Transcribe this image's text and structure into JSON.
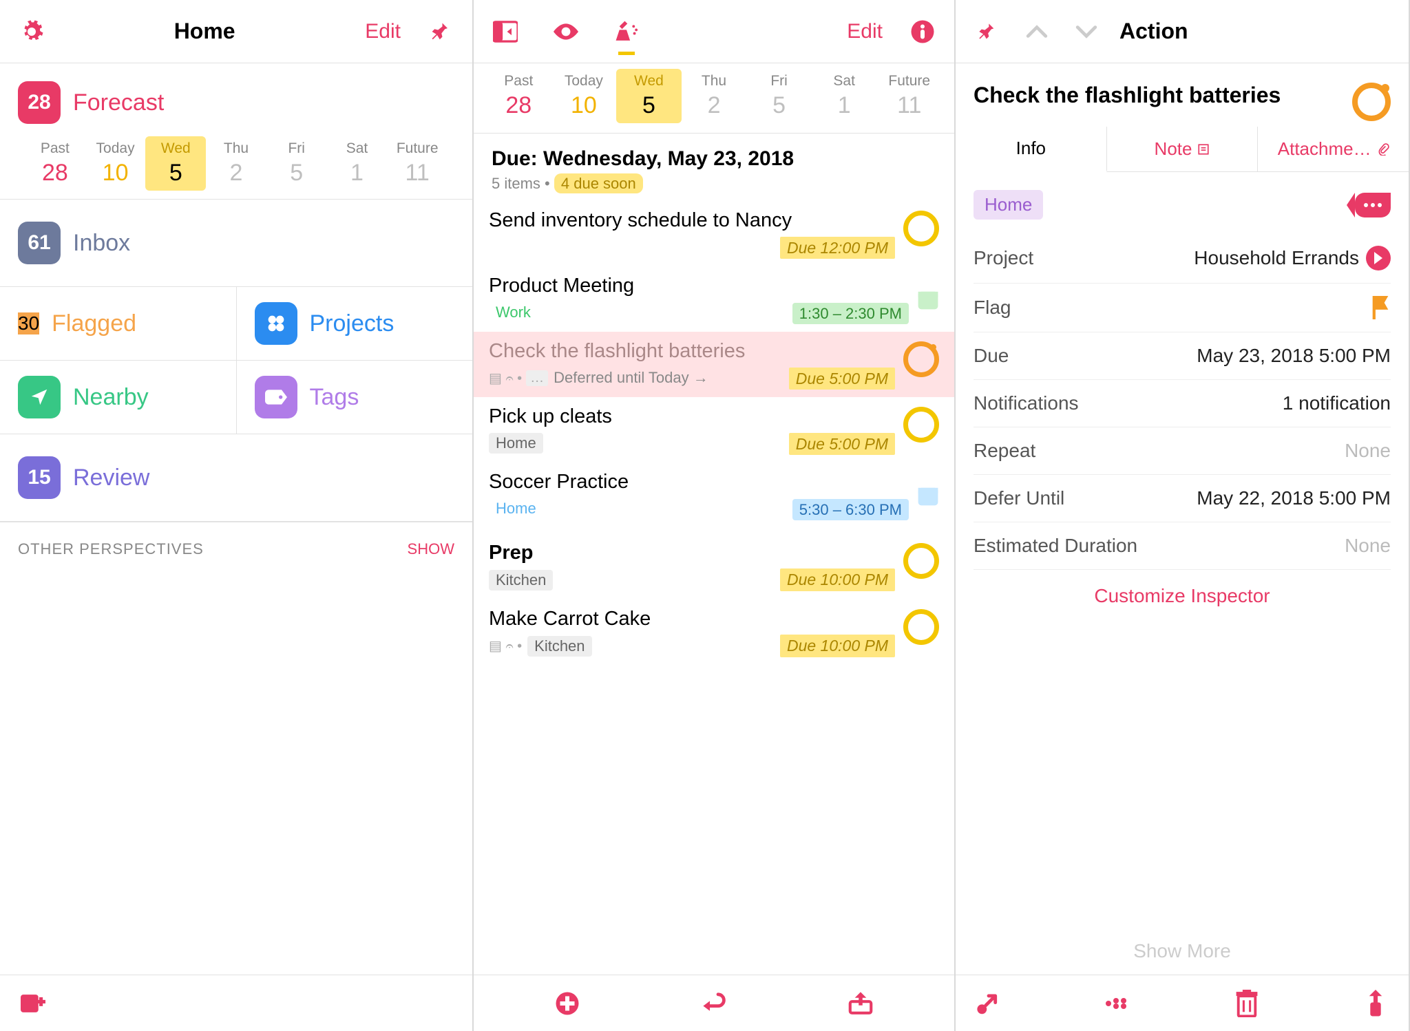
{
  "colors": {
    "pink": "#e83a66",
    "orange": "#f59b23",
    "yellow": "#f3c600"
  },
  "pane1": {
    "title": "Home",
    "edit": "Edit",
    "forecast": {
      "count": "28",
      "label": "Forecast"
    },
    "cal": [
      {
        "lbl": "Past",
        "num": "28",
        "cls": "past"
      },
      {
        "lbl": "Today",
        "num": "10",
        "cls": "today"
      },
      {
        "lbl": "Wed",
        "num": "5",
        "cls": "sel"
      },
      {
        "lbl": "Thu",
        "num": "2",
        "cls": ""
      },
      {
        "lbl": "Fri",
        "num": "5",
        "cls": ""
      },
      {
        "lbl": "Sat",
        "num": "1",
        "cls": ""
      },
      {
        "lbl": "Future",
        "num": "11",
        "cls": ""
      }
    ],
    "inbox": {
      "count": "61",
      "label": "Inbox"
    },
    "flagged": {
      "count": "30",
      "label": "Flagged"
    },
    "projects": "Projects",
    "nearby": "Nearby",
    "tags": "Tags",
    "review": {
      "count": "15",
      "label": "Review"
    },
    "other": "OTHER PERSPECTIVES",
    "show": "SHOW"
  },
  "pane2": {
    "edit": "Edit",
    "cal": [
      {
        "lbl": "Past",
        "num": "28",
        "cls": "past"
      },
      {
        "lbl": "Today",
        "num": "10",
        "cls": "today"
      },
      {
        "lbl": "Wed",
        "num": "5",
        "cls": "sel"
      },
      {
        "lbl": "Thu",
        "num": "2",
        "cls": ""
      },
      {
        "lbl": "Fri",
        "num": "5",
        "cls": ""
      },
      {
        "lbl": "Sat",
        "num": "1",
        "cls": ""
      },
      {
        "lbl": "Future",
        "num": "11",
        "cls": ""
      }
    ],
    "dueheader": "Due: Wednesday, May 23, 2018",
    "itemcount": "5 items",
    "duesoon": "4 due soon",
    "tasks": [
      {
        "title": "Send inventory schedule to Nancy",
        "due": "Due 12:00 PM"
      },
      {
        "title": "Product Meeting",
        "tag": "Work",
        "tagcls": "green",
        "time": "1:30 – 2:30 PM",
        "timecls": "",
        "cal": "green"
      },
      {
        "title": "Check the flashlight batteries",
        "meta": true,
        "defer": "Deferred until Today →",
        "due": "Due 5:00 PM",
        "sel": true,
        "circle": "orange flag"
      },
      {
        "title": "Pick up cleats",
        "tag": "Home",
        "tagcls": "",
        "due": "Due 5:00 PM"
      },
      {
        "title": "Soccer Practice",
        "tag": "Home",
        "tagcls": "blue",
        "time": "5:30 – 6:30 PM",
        "timecls": "blue",
        "cal": "blue"
      }
    ],
    "groupTitle": "Prep",
    "groupTag": "Kitchen",
    "groupDue": "Due 10:00 PM",
    "subtask": {
      "title": "Make Carrot Cake",
      "tag": "Kitchen",
      "due": "Due 10:00 PM",
      "meta": true
    }
  },
  "pane3": {
    "title": "Action",
    "task_title": "Check the flashlight batteries",
    "tabs": {
      "info": "Info",
      "note": "Note",
      "attach": "Attachme…"
    },
    "hometag": "Home",
    "rows": {
      "project_lbl": "Project",
      "project_val": "Household Errands",
      "flag_lbl": "Flag",
      "due_lbl": "Due",
      "due_val": "May 23, 2018  5:00 PM",
      "notif_lbl": "Notifications",
      "notif_val": "1 notification",
      "repeat_lbl": "Repeat",
      "repeat_val": "None",
      "defer_lbl": "Defer Until",
      "defer_val": "May 22, 2018  5:00 PM",
      "dur_lbl": "Estimated Duration",
      "dur_val": "None"
    },
    "customize": "Customize Inspector",
    "showmore": "Show More"
  }
}
